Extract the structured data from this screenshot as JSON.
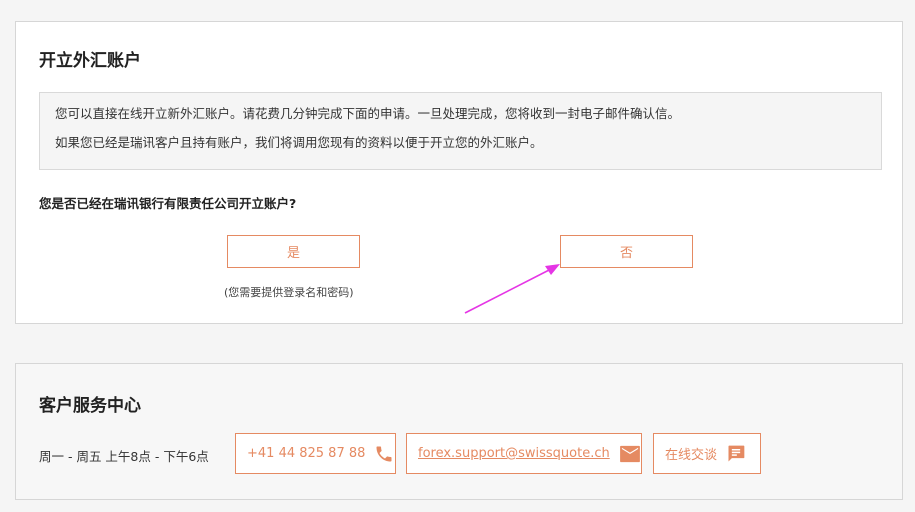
{
  "open_account": {
    "title": "开立外汇账户",
    "info_line1": "您可以直接在线开立新外汇账户。请花费几分钟完成下面的申请。一旦处理完成，您将收到一封电子邮件确认信。",
    "info_line2": "如果您已经是瑞讯客户且持有账户，我们将调用您现有的资料以便于开立您的外汇账户。",
    "question": "您是否已经在瑞讯银行有限责任公司开立账户?",
    "yes_label": "是",
    "no_label": "否",
    "yes_hint": "(您需要提供登录名和密码)"
  },
  "customer_service": {
    "title": "客户服务中心",
    "hours": "周一 - 周五 上午8点 - 下午6点",
    "phone": "+41 44 825 87 88",
    "email": "forex.support@swissquote.ch",
    "chat": "在线交谈"
  },
  "colors": {
    "accent": "#e58a62",
    "annotation_arrow": "#e535e5"
  },
  "icons": [
    "phone-icon",
    "mail-icon",
    "chat-icon"
  ]
}
